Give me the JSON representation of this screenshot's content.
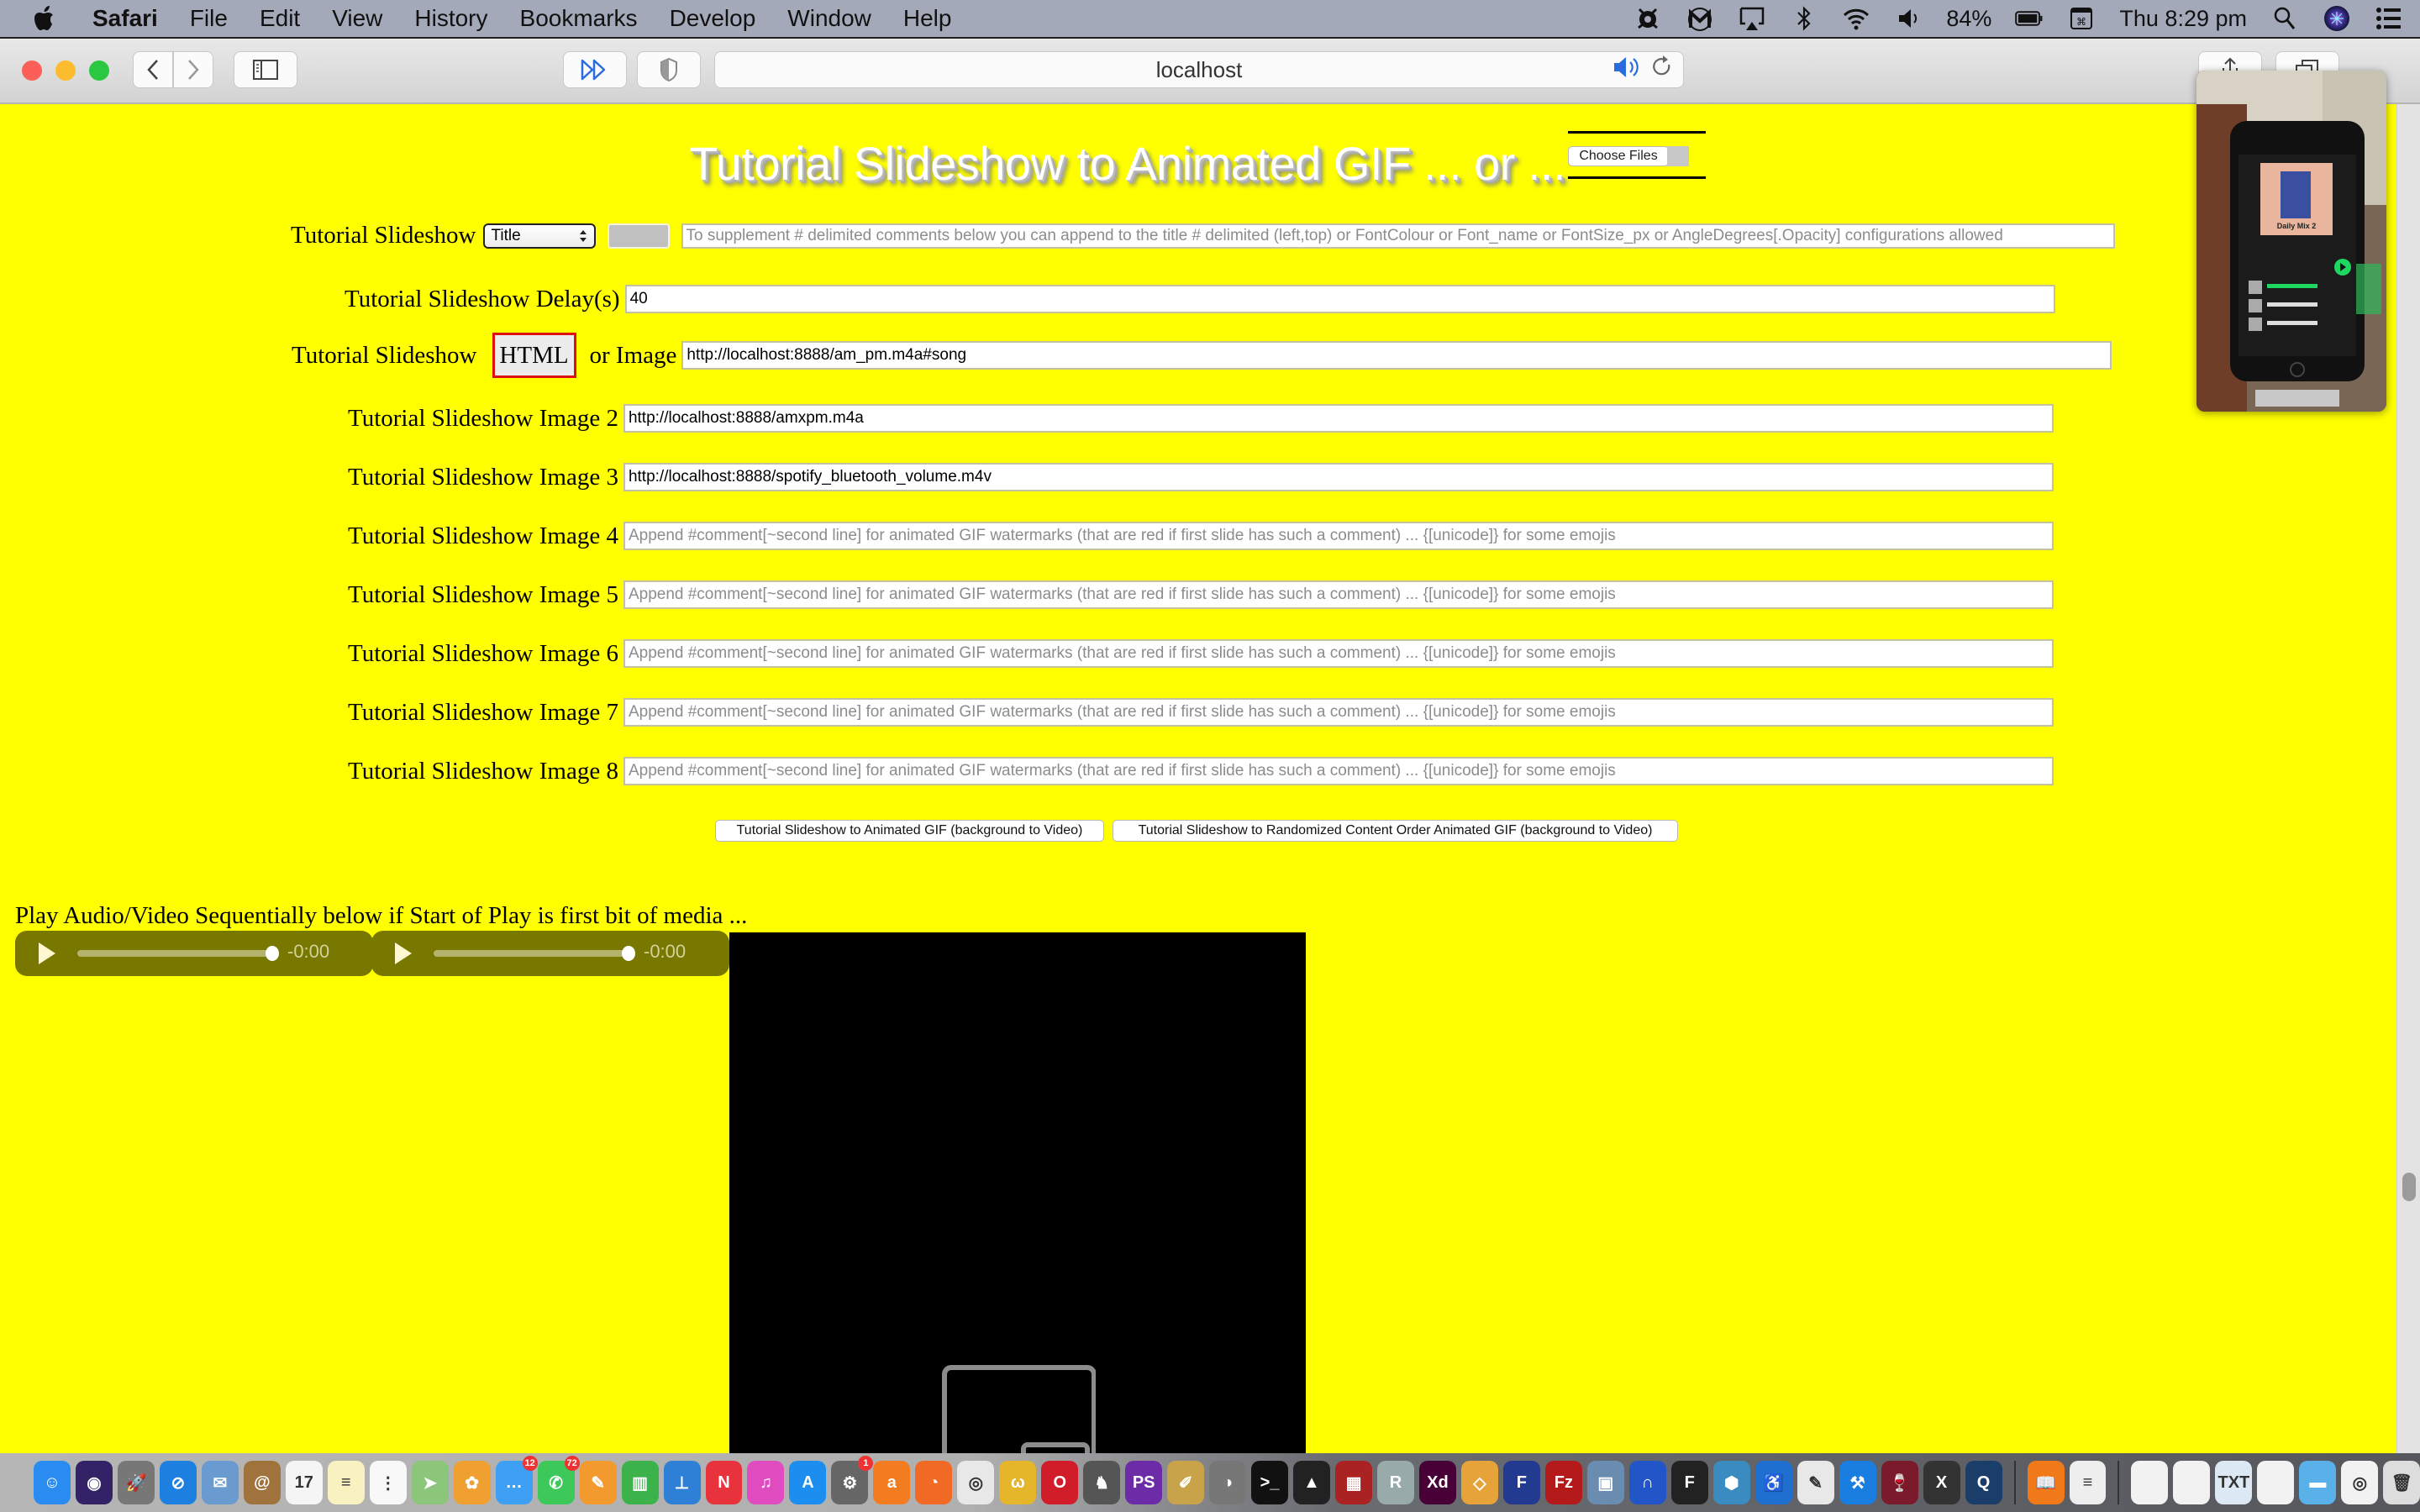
{
  "menubar": {
    "app_name": "Safari",
    "items": [
      "File",
      "Edit",
      "View",
      "History",
      "Bookmarks",
      "Develop",
      "Window",
      "Help"
    ],
    "status": {
      "icons": [
        "avast-icon",
        "malwarebytes-icon",
        "airplay-icon",
        "bluetooth-icon",
        "wifi-icon",
        "volume-icon"
      ],
      "battery": "84%",
      "clock": "Thu 8:29 pm"
    }
  },
  "browser": {
    "url": "localhost",
    "audio_playing": true
  },
  "page": {
    "title": "Tutorial Slideshow to Animated GIF ... or ...",
    "choose_files_label": "Choose Files",
    "title_row": {
      "label": "Tutorial Slideshow",
      "select_value": "Title",
      "swatch_color": "#c0c0c0",
      "placeholder": "To supplement # delimited comments below you can append to the title # delimited (left,top) or FontColour or Font_name or FontSize_px or AngleDegrees[.Opacity] configurations allowed"
    },
    "delay_row": {
      "label": "Tutorial Slideshow Delay(s)",
      "value": "40"
    },
    "image1_row": {
      "label": "Tutorial Slideshow",
      "html_button": "HTML",
      "or_label": "or Image",
      "value": "http://localhost:8888/am_pm.m4a#song"
    },
    "images": [
      {
        "label": "Tutorial Slideshow Image 2",
        "value": "http://localhost:8888/amxpm.m4a",
        "placeholder": ""
      },
      {
        "label": "Tutorial Slideshow Image 3",
        "value": "http://localhost:8888/spotify_bluetooth_volume.m4v",
        "placeholder": ""
      },
      {
        "label": "Tutorial Slideshow Image 4",
        "value": "",
        "placeholder": "Append #comment[~second line] for animated GIF watermarks (that are red if first slide has such a comment) ... {[unicode]} for some emojis"
      },
      {
        "label": "Tutorial Slideshow Image 5",
        "value": "",
        "placeholder": "Append #comment[~second line] for animated GIF watermarks (that are red if first slide has such a comment) ... {[unicode]} for some emojis"
      },
      {
        "label": "Tutorial Slideshow Image 6",
        "value": "",
        "placeholder": "Append #comment[~second line] for animated GIF watermarks (that are red if first slide has such a comment) ... {[unicode]} for some emojis"
      },
      {
        "label": "Tutorial Slideshow Image 7",
        "value": "",
        "placeholder": "Append #comment[~second line] for animated GIF watermarks (that are red if first slide has such a comment) ... {[unicode]} for some emojis"
      },
      {
        "label": "Tutorial Slideshow Image 8",
        "value": "",
        "placeholder": "Append #comment[~second line] for animated GIF watermarks (that are red if first slide has such a comment) ... {[unicode]} for some emojis"
      }
    ],
    "buttons": {
      "to_gif": "Tutorial Slideshow to Animated GIF (background to Video)",
      "to_random_gif": "Tutorial Slideshow to Randomized Content Order Animated GIF (background to Video)"
    },
    "play_label": "Play Audio/Video Sequentially below if Start of Play is first bit of media ...",
    "audio_players": [
      {
        "time": "-0:00",
        "progress_percent": 100
      },
      {
        "time": "-0:00",
        "progress_percent": 100
      }
    ],
    "video": {
      "state": "picture-in-picture"
    },
    "pip": {
      "content": "Phone showing Spotify Daily Mix 2"
    },
    "background_color": "#ffff00"
  },
  "dock": {
    "apps": [
      {
        "name": "Finder",
        "icon": "finder-icon",
        "color": "#2a8cf0",
        "glyph": "☺"
      },
      {
        "name": "Siri",
        "icon": "siri-icon",
        "color": "#332266",
        "glyph": "◉"
      },
      {
        "name": "Launchpad",
        "icon": "launchpad-icon",
        "color": "#777",
        "glyph": "🚀"
      },
      {
        "name": "Safari",
        "icon": "safari-icon",
        "color": "#1d7fe0",
        "glyph": "⊘"
      },
      {
        "name": "Mail",
        "icon": "mail-icon",
        "color": "#6a9bd0",
        "glyph": "✉"
      },
      {
        "name": "Contacts",
        "icon": "contacts-icon",
        "color": "#a0733c",
        "glyph": "@"
      },
      {
        "name": "Calendar",
        "icon": "calendar-icon",
        "color": "#f5f5f5",
        "glyph": "17",
        "dark": true
      },
      {
        "name": "Notes",
        "icon": "notes-icon",
        "color": "#f8f2c0",
        "glyph": "≡",
        "dark": true
      },
      {
        "name": "Reminders",
        "icon": "reminders-icon",
        "color": "#f8f8f8",
        "glyph": "⋮",
        "dark": true
      },
      {
        "name": "Maps",
        "icon": "maps-icon",
        "color": "#8cc67a",
        "glyph": "➤"
      },
      {
        "name": "Photos",
        "icon": "photos-icon",
        "color": "#f0a030",
        "glyph": "✿"
      },
      {
        "name": "Messages",
        "icon": "messages-icon",
        "color": "#3ea0f5",
        "glyph": "…",
        "badge": "12"
      },
      {
        "name": "FaceTime",
        "icon": "facetime-icon",
        "color": "#3cc95a",
        "glyph": "✆",
        "badge": "72"
      },
      {
        "name": "Pages",
        "icon": "pages-icon",
        "color": "#f29a2e",
        "glyph": "✎"
      },
      {
        "name": "Numbers",
        "icon": "numbers-icon",
        "color": "#3bb24a",
        "glyph": "▥"
      },
      {
        "name": "Keynote",
        "icon": "keynote-icon",
        "color": "#2e7fd6",
        "glyph": "⊥"
      },
      {
        "name": "News",
        "icon": "news-icon",
        "color": "#e8323c",
        "glyph": "N"
      },
      {
        "name": "iTunes",
        "icon": "itunes-icon",
        "color": "#e04bc0",
        "glyph": "♫"
      },
      {
        "name": "App Store",
        "icon": "appstore-icon",
        "color": "#1c8ef0",
        "glyph": "A"
      },
      {
        "name": "System Preferences",
        "icon": "system-preferences-icon",
        "color": "#666",
        "glyph": "⚙",
        "badge": "1"
      },
      {
        "name": "Avast",
        "icon": "avast-icon",
        "color": "#f47c20",
        "glyph": "a"
      },
      {
        "name": "Firefox",
        "icon": "firefox-icon",
        "color": "#f06a25",
        "glyph": "◔"
      },
      {
        "name": "Chrome",
        "icon": "chrome-icon",
        "color": "#e8e8e8",
        "glyph": "◎",
        "dark": true
      },
      {
        "name": "Cyberduck",
        "icon": "cyberduck-icon",
        "color": "#e5b52a",
        "glyph": "ω"
      },
      {
        "name": "Opera",
        "icon": "opera-icon",
        "color": "#d11c2a",
        "glyph": "O"
      },
      {
        "name": "Sequel Pro",
        "icon": "sequel-pro-icon",
        "color": "#555",
        "glyph": "♞"
      },
      {
        "name": "PhpStorm",
        "icon": "phpstorm-icon",
        "color": "#6c2ca8",
        "glyph": "PS"
      },
      {
        "name": "Xcode Instruments",
        "icon": "brush-icon",
        "color": "#c9a34a",
        "glyph": "✐"
      },
      {
        "name": "GIMP",
        "icon": "gimp-icon",
        "color": "#777",
        "glyph": "◑"
      },
      {
        "name": "Terminal",
        "icon": "terminal-icon",
        "color": "#111",
        "glyph": ">_"
      },
      {
        "name": "Inkscape",
        "icon": "inkscape-icon",
        "color": "#222",
        "glyph": "▲"
      },
      {
        "name": "Photo Booth",
        "icon": "photo-booth-icon",
        "color": "#a22",
        "glyph": "▦"
      },
      {
        "name": "R",
        "icon": "r-icon",
        "color": "#9aa",
        "glyph": "R"
      },
      {
        "name": "Adobe XD",
        "icon": "adobe-xd-icon",
        "color": "#470137",
        "glyph": "Xd"
      },
      {
        "name": "Sketch",
        "icon": "sketch-icon",
        "color": "#e6a33a",
        "glyph": "◇"
      },
      {
        "name": "Flow",
        "icon": "flow-icon",
        "color": "#223a90",
        "glyph": "F"
      },
      {
        "name": "FileZilla",
        "icon": "filezilla-icon",
        "color": "#b41a1a",
        "glyph": "Fz"
      },
      {
        "name": "Preview",
        "icon": "preview-icon",
        "color": "#6a8cb0",
        "glyph": "▣"
      },
      {
        "name": "Audacity",
        "icon": "audacity-icon",
        "color": "#2255c8",
        "glyph": "∩"
      },
      {
        "name": "Fontforge",
        "icon": "f-icon",
        "color": "#222",
        "glyph": "F"
      },
      {
        "name": "Blender",
        "icon": "cube-icon",
        "color": "#3a8cc0",
        "glyph": "⬢"
      },
      {
        "name": "Accessibility",
        "icon": "accessibility-icon",
        "color": "#1e6fd0",
        "glyph": "♿"
      },
      {
        "name": "TextEdit",
        "icon": "script-icon",
        "color": "#e8e8e8",
        "glyph": "✎",
        "dark": true
      },
      {
        "name": "Xcode",
        "icon": "xcode-icon",
        "color": "#1a7ee0",
        "glyph": "⚒"
      },
      {
        "name": "Wine",
        "icon": "wine-icon",
        "color": "#7a1a2a",
        "glyph": "🍷"
      },
      {
        "name": "X11",
        "icon": "x11-icon",
        "color": "#333",
        "glyph": "X"
      },
      {
        "name": "QuickTime",
        "icon": "quicktime-icon",
        "color": "#1a3d6a",
        "glyph": "Q"
      }
    ],
    "recent": [
      {
        "name": "Books",
        "icon": "books-icon",
        "color": "#f07a1a",
        "glyph": "📖"
      },
      {
        "name": "Document",
        "icon": "document-icon",
        "color": "#eee",
        "glyph": "≡",
        "dark": true
      }
    ],
    "stacks": [
      {
        "name": "File 1",
        "icon": "file-icon",
        "color": "#f2f2f2",
        "glyph": "",
        "dark": true
      },
      {
        "name": "File 2",
        "icon": "file-icon",
        "color": "#f2f2f2",
        "glyph": "",
        "dark": true
      },
      {
        "name": "Text File",
        "icon": "text-file-icon",
        "color": "#dde8f5",
        "glyph": "TXT",
        "dark": true
      },
      {
        "name": "Script File",
        "icon": "script-file-icon",
        "color": "#f2f2f2",
        "glyph": "",
        "dark": true
      },
      {
        "name": "Downloads",
        "icon": "folder-icon",
        "color": "#5ab0e8",
        "glyph": "▬"
      },
      {
        "name": "Web Page",
        "icon": "webpage-icon",
        "color": "#f2f2f2",
        "glyph": "◎",
        "dark": true
      },
      {
        "name": "Trash",
        "icon": "trash-icon",
        "color": "#ddd",
        "glyph": "🗑",
        "dark": true
      }
    ]
  }
}
